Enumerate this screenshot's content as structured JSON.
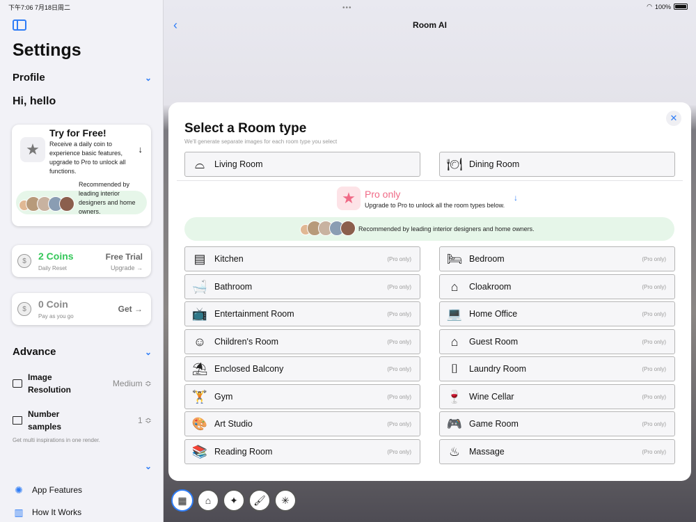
{
  "status": {
    "time": "下午7:06  7月18日周二",
    "battery": "100%"
  },
  "sidebar": {
    "title": "Settings",
    "profile_label": "Profile",
    "greeting": "Hi, hello",
    "try_card": {
      "title": "Try for Free!",
      "desc": "Receive a daily coin to experience basic features, upgrade to Pro to unlock all functions.",
      "rec_text": "Recommended by leading interior designers and home owners."
    },
    "coins_card": {
      "main": "2 Coins",
      "sub": "Daily Reset",
      "right": "Free Trial",
      "right_sub": "Upgrade →"
    },
    "pay_card": {
      "main": "0 Coin",
      "sub": "Pay as you go",
      "right": "Get →"
    },
    "advance_label": "Advance",
    "image_resolution": {
      "label": "Image Resolution",
      "value": "Medium ≎"
    },
    "number_samples": {
      "label": "Number samples",
      "value": "1 ≎"
    },
    "hint": "Get multi inspirations in one render.",
    "links": [
      {
        "label": "App Features",
        "icon": "sparkle-ring-icon"
      },
      {
        "label": "How It Works",
        "icon": "book-icon"
      }
    ],
    "colors": {
      "accent": "#2f7df6",
      "coin_green": "#34c759",
      "pro_pink": "#f06a86"
    }
  },
  "main": {
    "nav_title": "Room AI",
    "sheet": {
      "title": "Select a Room type",
      "subtitle": "We'll generate separate images for each room type you select",
      "free_rooms": [
        {
          "label": "Living Room",
          "icon": "sofa-icon"
        },
        {
          "label": "Dining Room",
          "icon": "dining-icon"
        }
      ],
      "pro_title": "Pro only",
      "pro_subtitle": "Upgrade to Pro to unlock all the room types below.",
      "rec_text": "Recommended by leading interior designers and home owners.",
      "pro_tag": "(Pro only)",
      "pro_rooms_left": [
        {
          "label": "Kitchen",
          "icon": "kitchen-icon"
        },
        {
          "label": "Bathroom",
          "icon": "bathtub-icon"
        },
        {
          "label": "Entertainment Room",
          "icon": "tv-icon"
        },
        {
          "label": "Children's Room",
          "icon": "baby-icon"
        },
        {
          "label": "Enclosed Balcony",
          "icon": "balcony-icon"
        },
        {
          "label": "Gym",
          "icon": "dumbbell-icon"
        },
        {
          "label": "Art Studio",
          "icon": "palette-icon"
        },
        {
          "label": "Reading Room",
          "icon": "books-icon"
        }
      ],
      "pro_rooms_right": [
        {
          "label": "Bedroom",
          "icon": "bed-icon"
        },
        {
          "label": "Cloakroom",
          "icon": "hanger-icon"
        },
        {
          "label": "Home Office",
          "icon": "laptop-icon"
        },
        {
          "label": "Guest Room",
          "icon": "guest-icon"
        },
        {
          "label": "Laundry Room",
          "icon": "washer-icon"
        },
        {
          "label": "Wine Cellar",
          "icon": "barrel-icon"
        },
        {
          "label": "Game Room",
          "icon": "gamepad-icon"
        },
        {
          "label": "Massage",
          "icon": "massage-icon"
        }
      ]
    },
    "tools": [
      "room-type-tool-icon",
      "home-tool-icon",
      "sparkle-tool-icon",
      "brush-tool-icon",
      "magic-wand-tool-icon"
    ]
  }
}
